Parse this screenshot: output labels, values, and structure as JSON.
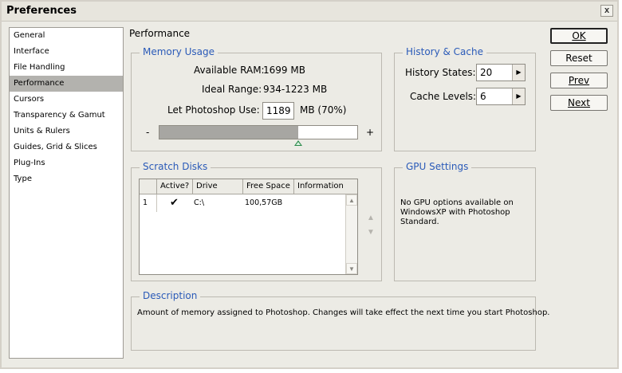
{
  "window": {
    "title": "Preferences",
    "close_glyph": "x"
  },
  "sidebar": {
    "items": [
      {
        "label": "General"
      },
      {
        "label": "Interface"
      },
      {
        "label": "File Handling"
      },
      {
        "label": "Performance",
        "selected": true
      },
      {
        "label": "Cursors"
      },
      {
        "label": "Transparency & Gamut"
      },
      {
        "label": "Units & Rulers"
      },
      {
        "label": "Guides, Grid & Slices"
      },
      {
        "label": "Plug-Ins"
      },
      {
        "label": "Type"
      }
    ]
  },
  "page": {
    "title": "Performance"
  },
  "memory": {
    "legend": "Memory Usage",
    "available_label": "Available RAM:",
    "available_value": "1699 MB",
    "ideal_label": "Ideal Range:",
    "ideal_value": "934-1223 MB",
    "use_label": "Let Photoshop Use:",
    "use_value": "1189",
    "use_suffix": "MB (70%)",
    "minus": "-",
    "plus": "+",
    "slider_fraction": 0.7
  },
  "history": {
    "legend": "History & Cache",
    "states_label": "History States:",
    "states_value": "20",
    "cache_label": "Cache Levels:",
    "cache_value": "6"
  },
  "scratch": {
    "legend": "Scratch Disks",
    "columns": [
      "Active?",
      "Drive",
      "Free Space",
      "Information"
    ],
    "rows": [
      {
        "num": "1",
        "active": true,
        "drive": "C:\\",
        "free": "100,57GB",
        "info": ""
      }
    ]
  },
  "gpu": {
    "legend": "GPU Settings",
    "message_line1": "No GPU options available on",
    "message_line2": "WindowsXP with Photoshop",
    "message_line3": "Standard."
  },
  "description": {
    "legend": "Description",
    "text": "Amount of memory assigned to Photoshop. Changes will take effect the next time you start Photoshop."
  },
  "buttons": {
    "ok": "OK",
    "reset": "Reset",
    "prev": "Prev",
    "next": "Next"
  },
  "colors": {
    "legend": "#2a5ab8",
    "slider_thumb": "#2c8a4b"
  },
  "icons": {
    "close": "close-icon",
    "spin": "triangle-right-icon",
    "move_up": "triangle-up-icon",
    "move_down": "triangle-down-icon",
    "check": "checkmark-icon"
  }
}
